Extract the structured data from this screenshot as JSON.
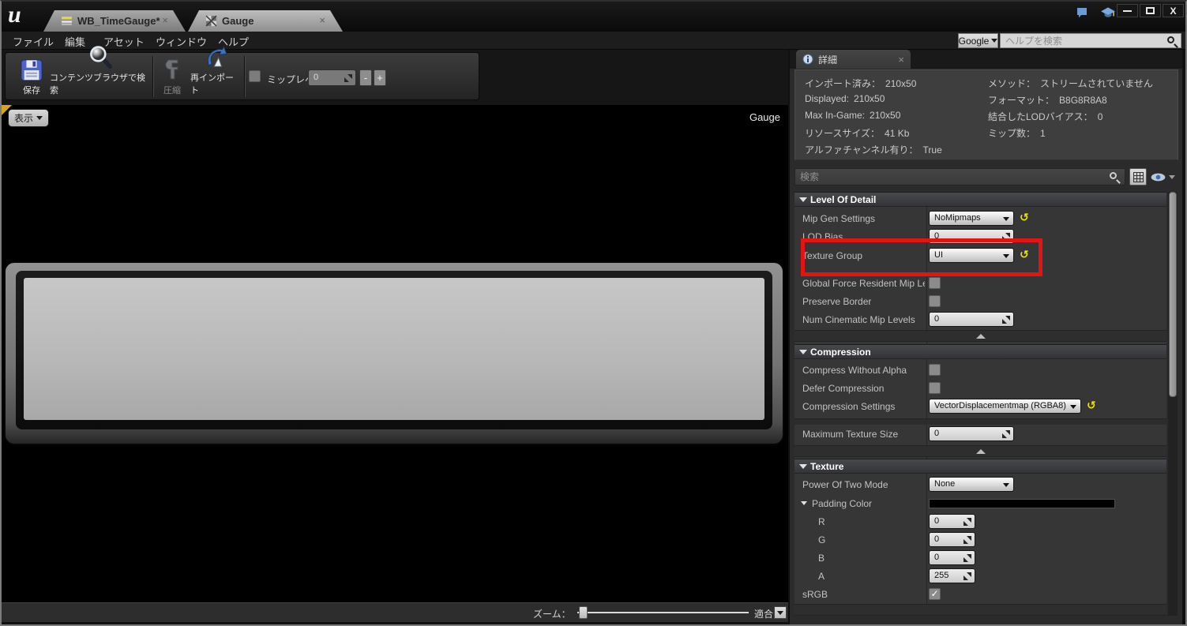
{
  "titlebar": {
    "tabs": [
      {
        "label": "WB_TimeGauge*",
        "close": "×"
      },
      {
        "label": "Gauge",
        "close": "×"
      }
    ]
  },
  "menubar": {
    "items": [
      "ファイル",
      "編集",
      "アセット",
      "ウィンドウ",
      "ヘルプ"
    ],
    "search_engine": "Google",
    "help_search_placeholder": "ヘルプを検索"
  },
  "toolbar": {
    "save": "保存",
    "find_in_cb": "コンテンツブラウザで検索",
    "compress": "圧縮",
    "reimport": "再インポート",
    "mip_level_label": "ミップレベル：",
    "mip_level_value": "0",
    "mip_minus": "-",
    "mip_plus": "+"
  },
  "viewport": {
    "view_menu": "表示",
    "texture_label": "Gauge",
    "zoom_label": "ズーム：",
    "fit_label": "適合"
  },
  "details": {
    "tab_title": "詳細",
    "tab_close": "×",
    "info_left": [
      {
        "label": "インポート済み：",
        "value": "210x50"
      },
      {
        "label": "Displayed:",
        "value": "210x50"
      },
      {
        "label": "Max In-Game:",
        "value": "210x50"
      },
      {
        "label": "リソースサイズ：",
        "value": "41 Kb"
      },
      {
        "label": "アルファチャンネル有り：",
        "value": "True"
      }
    ],
    "info_right": [
      {
        "label": "メソッド：",
        "value": "ストリームされていません"
      },
      {
        "label": "フォーマット：",
        "value": "B8G8R8A8"
      },
      {
        "label": "結合したLODバイアス：",
        "value": "0"
      },
      {
        "label": "ミップ数：",
        "value": "1"
      }
    ],
    "search_placeholder": "検索",
    "lod": {
      "title": "Level Of Detail",
      "mip_gen": {
        "label": "Mip Gen Settings",
        "value": "NoMipmaps"
      },
      "lod_bias": {
        "label": "LOD Bias",
        "value": "0"
      },
      "texture_group": {
        "label": "Texture Group",
        "value": "UI"
      },
      "global_force": {
        "label": "Global Force Resident Mip Le"
      },
      "preserve_border": {
        "label": "Preserve Border"
      },
      "num_cinematic": {
        "label": "Num Cinematic Mip Levels",
        "value": "0"
      }
    },
    "compression": {
      "title": "Compression",
      "compress_without_alpha": {
        "label": "Compress Without Alpha"
      },
      "defer_compression": {
        "label": "Defer Compression"
      },
      "settings": {
        "label": "Compression Settings",
        "value": "VectorDisplacementmap (RGBA8)"
      },
      "max_texture_size": {
        "label": "Maximum Texture Size",
        "value": "0"
      }
    },
    "texture": {
      "title": "Texture",
      "power_of_two": {
        "label": "Power Of Two Mode",
        "value": "None"
      },
      "padding_color": {
        "label": "Padding Color",
        "color": "#000000"
      },
      "r": {
        "label": "R",
        "value": "0"
      },
      "g": {
        "label": "G",
        "value": "0"
      },
      "b": {
        "label": "B",
        "value": "0"
      },
      "a": {
        "label": "A",
        "value": "255"
      },
      "srgb": {
        "label": "sRGB",
        "checked": true,
        "glyph": "✓"
      }
    }
  },
  "annotation": {
    "highlight_color": "#e51414",
    "highlighted_row": "Texture Group"
  }
}
